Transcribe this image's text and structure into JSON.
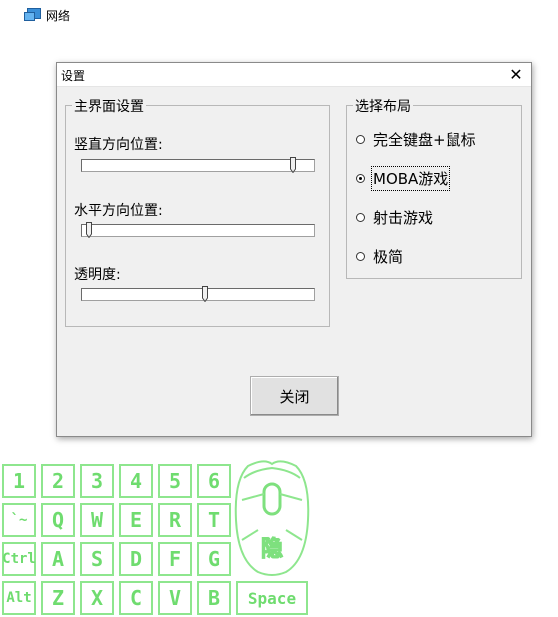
{
  "desktop": {
    "network_label": "网络"
  },
  "dialog": {
    "title": "设置",
    "close_symbol": "✕",
    "main_group": {
      "title": "主界面设置",
      "vertical_label": "竖直方向位置:",
      "vertical_value": 0.9,
      "horizontal_label": "水平方向位置:",
      "horizontal_value": 0.02,
      "opacity_label": "透明度:",
      "opacity_value": 0.52
    },
    "layout_group": {
      "title": "选择布局",
      "options": [
        "完全键盘+鼠标",
        "MOBA游戏",
        "射击游戏",
        "极简"
      ],
      "selected_index": 1
    },
    "close_button": "关闭"
  },
  "overlay": {
    "accent_color": "#7ee07e",
    "rows": [
      [
        "1",
        "2",
        "3",
        "4",
        "5",
        "6"
      ],
      [
        "`~",
        "Q",
        "W",
        "E",
        "R",
        "T"
      ],
      [
        "Ctrl",
        "A",
        "S",
        "D",
        "F",
        "G"
      ],
      [
        "Alt",
        "Z",
        "X",
        "C",
        "V",
        "B"
      ]
    ],
    "space_key": "Space",
    "mouse_glyph": "隐"
  }
}
